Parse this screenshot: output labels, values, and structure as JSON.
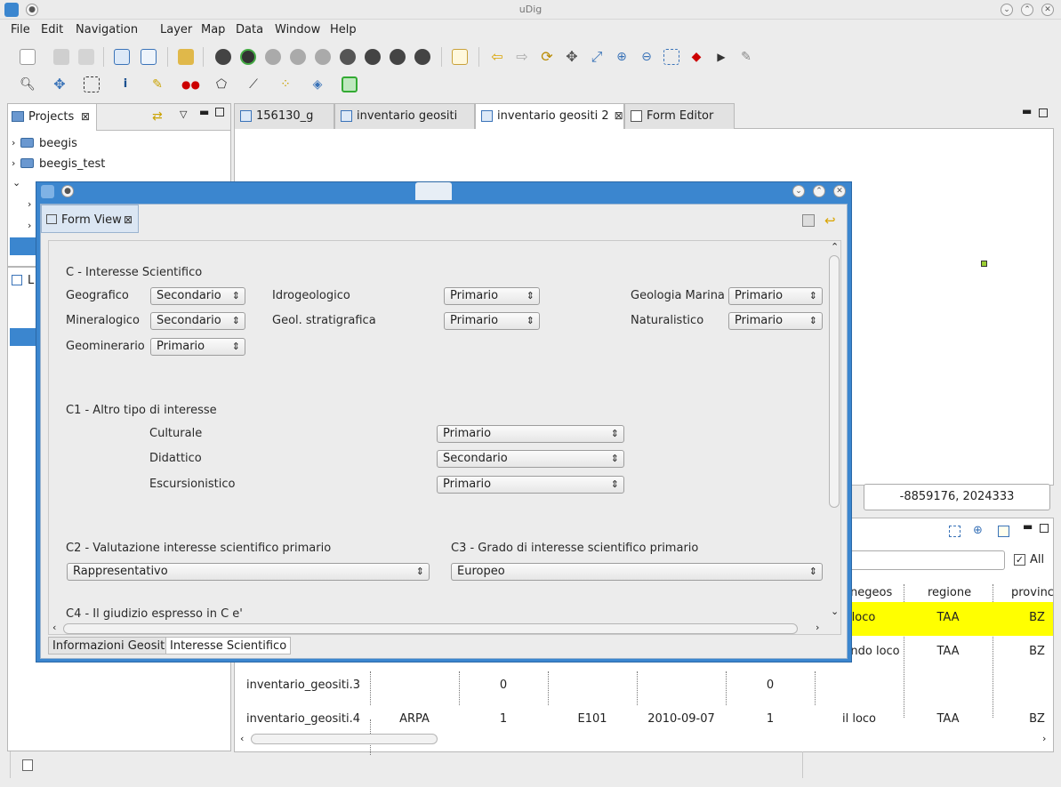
{
  "window": {
    "title": "uDig"
  },
  "menu": [
    "File",
    "Edit",
    "Navigation",
    "Layer",
    "Map",
    "Data",
    "Window",
    "Help"
  ],
  "projects_panel": {
    "tab_label": "Projects",
    "items": [
      "beegis",
      "beegis_test"
    ],
    "layers_tab_partial": "L"
  },
  "editor_tabs": [
    "156130_g",
    "inventario geositi",
    "inventario geositi 2",
    "Form Editor"
  ],
  "map": {
    "coordinates": "-8859176, 2024333"
  },
  "table": {
    "filter_all_label": "All",
    "headers": [
      "negeos",
      "regione",
      "provinc"
    ],
    "rows": [
      {
        "name": "",
        "c1": "",
        "c2": "",
        "c3": "",
        "c4": "",
        "c5": "",
        "negeos": "loco",
        "regione": "TAA",
        "provincia": "BZ"
      },
      {
        "name": "",
        "c1": "",
        "c2": "",
        "c3": "",
        "c4": "",
        "c5": "",
        "negeos": "ndo loco",
        "regione": "TAA",
        "provincia": "BZ"
      },
      {
        "name": "inventario_geositi.3",
        "c1": "",
        "c2": "0",
        "c3": "",
        "c4": "",
        "c5": "0",
        "negeos": "",
        "regione": "",
        "provincia": ""
      },
      {
        "name": "inventario_geositi.4",
        "c1": "ARPA",
        "c2": "1",
        "c3": "E101",
        "c4": "2010-09-07",
        "c5": "1",
        "negeos": "il loco",
        "regione": "TAA",
        "provincia": "BZ"
      }
    ],
    "highlight_color": "#ffff00"
  },
  "dialog": {
    "view_tab": "Form View",
    "section_c": {
      "title": "C - Interesse Scientifico",
      "fields": [
        {
          "label": "Geografico",
          "value": "Secondario"
        },
        {
          "label": "Mineralogico",
          "value": "Secondario"
        },
        {
          "label": "Geominerario",
          "value": "Primario"
        },
        {
          "label": "Idrogeologico",
          "value": "Primario"
        },
        {
          "label": "Geol. stratigrafica",
          "value": "Primario"
        },
        {
          "label": "Geologia Marina",
          "value": "Primario"
        },
        {
          "label": "Naturalistico",
          "value": "Primario"
        }
      ]
    },
    "section_c1": {
      "title": "C1 - Altro tipo di interesse",
      "fields": [
        {
          "label": "Culturale",
          "value": "Primario"
        },
        {
          "label": "Didattico",
          "value": "Secondario"
        },
        {
          "label": "Escursionistico",
          "value": "Primario"
        }
      ]
    },
    "section_c2": {
      "title": "C2 - Valutazione interesse scientifico primario",
      "value": "Rappresentativo"
    },
    "section_c3": {
      "title": "C3 - Grado di interesse scientifico primario",
      "value": "Europeo"
    },
    "section_c4": {
      "title": "C4 - Il giudizio espresso in C e'"
    },
    "bottom_tabs": [
      "Informazioni Geosito",
      "Interesse Scientifico"
    ]
  },
  "colors": {
    "dialog_frame": "#3b86cf",
    "selection": "#3b86cf"
  }
}
